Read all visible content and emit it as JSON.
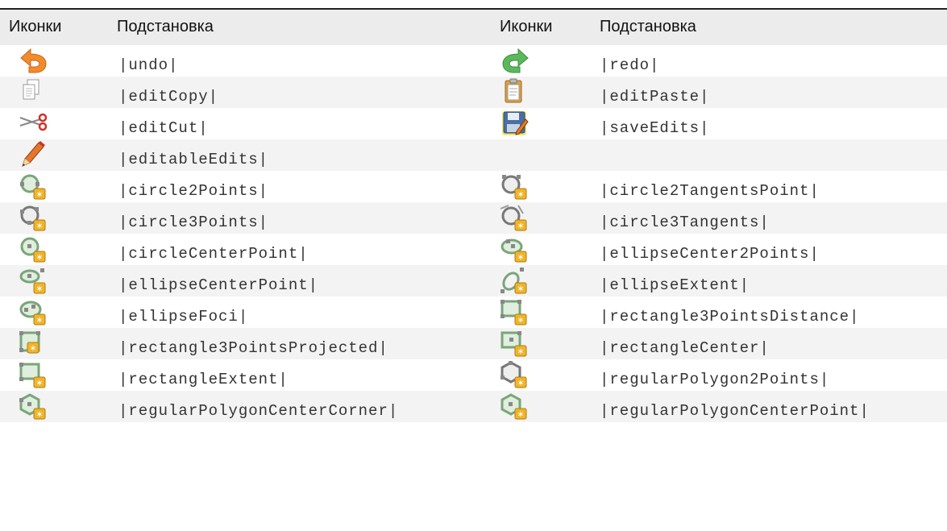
{
  "header": {
    "col_icons_left": "Иконки",
    "col_sub_left": "Подстановка",
    "col_icons_right": "Иконки",
    "col_sub_right": "Подстановка"
  },
  "rows": [
    {
      "left": {
        "icon": "undo-arrow-icon",
        "text": "|undo|"
      },
      "right": {
        "icon": "redo-arrow-icon",
        "text": "|redo|"
      }
    },
    {
      "left": {
        "icon": "copy-document-icon",
        "text": "|editCopy|"
      },
      "right": {
        "icon": "paste-clipboard-icon",
        "text": "|editPaste|"
      }
    },
    {
      "left": {
        "icon": "scissors-icon",
        "text": "|editCut|"
      },
      "right": {
        "icon": "save-floppy-edit-icon",
        "text": "|saveEdits|"
      }
    },
    {
      "left": {
        "icon": "pencil-icon",
        "text": "|editableEdits|"
      },
      "right": {
        "icon": "",
        "text": ""
      }
    },
    {
      "left": {
        "icon": "circle-2-points-icon",
        "text": "|circle2Points|"
      },
      "right": {
        "icon": "circle-2-tangents-point-icon",
        "text": "|circle2TangentsPoint|"
      }
    },
    {
      "left": {
        "icon": "circle-3-points-icon",
        "text": "|circle3Points|"
      },
      "right": {
        "icon": "circle-3-tangents-icon",
        "text": "|circle3Tangents|"
      }
    },
    {
      "left": {
        "icon": "circle-center-point-icon",
        "text": "|circleCenterPoint|"
      },
      "right": {
        "icon": "ellipse-center-2-points-icon",
        "text": "|ellipseCenter2Points|"
      }
    },
    {
      "left": {
        "icon": "ellipse-center-point-icon",
        "text": "|ellipseCenterPoint|"
      },
      "right": {
        "icon": "ellipse-extent-icon",
        "text": "|ellipseExtent|"
      }
    },
    {
      "left": {
        "icon": "ellipse-foci-icon",
        "text": "|ellipseFoci|"
      },
      "right": {
        "icon": "rectangle-3-points-distance-icon",
        "text": "|rectangle3PointsDistance|"
      }
    },
    {
      "left": {
        "icon": "rectangle-3-points-projected-icon",
        "text": "|rectangle3PointsProjected|"
      },
      "right": {
        "icon": "rectangle-center-icon",
        "text": "|rectangleCenter|"
      }
    },
    {
      "left": {
        "icon": "rectangle-extent-icon",
        "text": "|rectangleExtent|"
      },
      "right": {
        "icon": "regular-polygon-2-points-icon",
        "text": "|regularPolygon2Points|"
      }
    },
    {
      "left": {
        "icon": "regular-polygon-center-corner-icon",
        "text": "|regularPolygonCenterCorner|"
      },
      "right": {
        "icon": "regular-polygon-center-point-icon",
        "text": "|regularPolygonCenterPoint|"
      }
    }
  ],
  "colors": {
    "header_bg": "#ececec",
    "alt_row_bg": "#f3f3f3",
    "undo_orange": "#f28a2e",
    "redo_green": "#5cb85c",
    "shape_gray": "#8d8d8d",
    "shape_green": "#8fbf8f",
    "star_badge": "#f0b429"
  }
}
